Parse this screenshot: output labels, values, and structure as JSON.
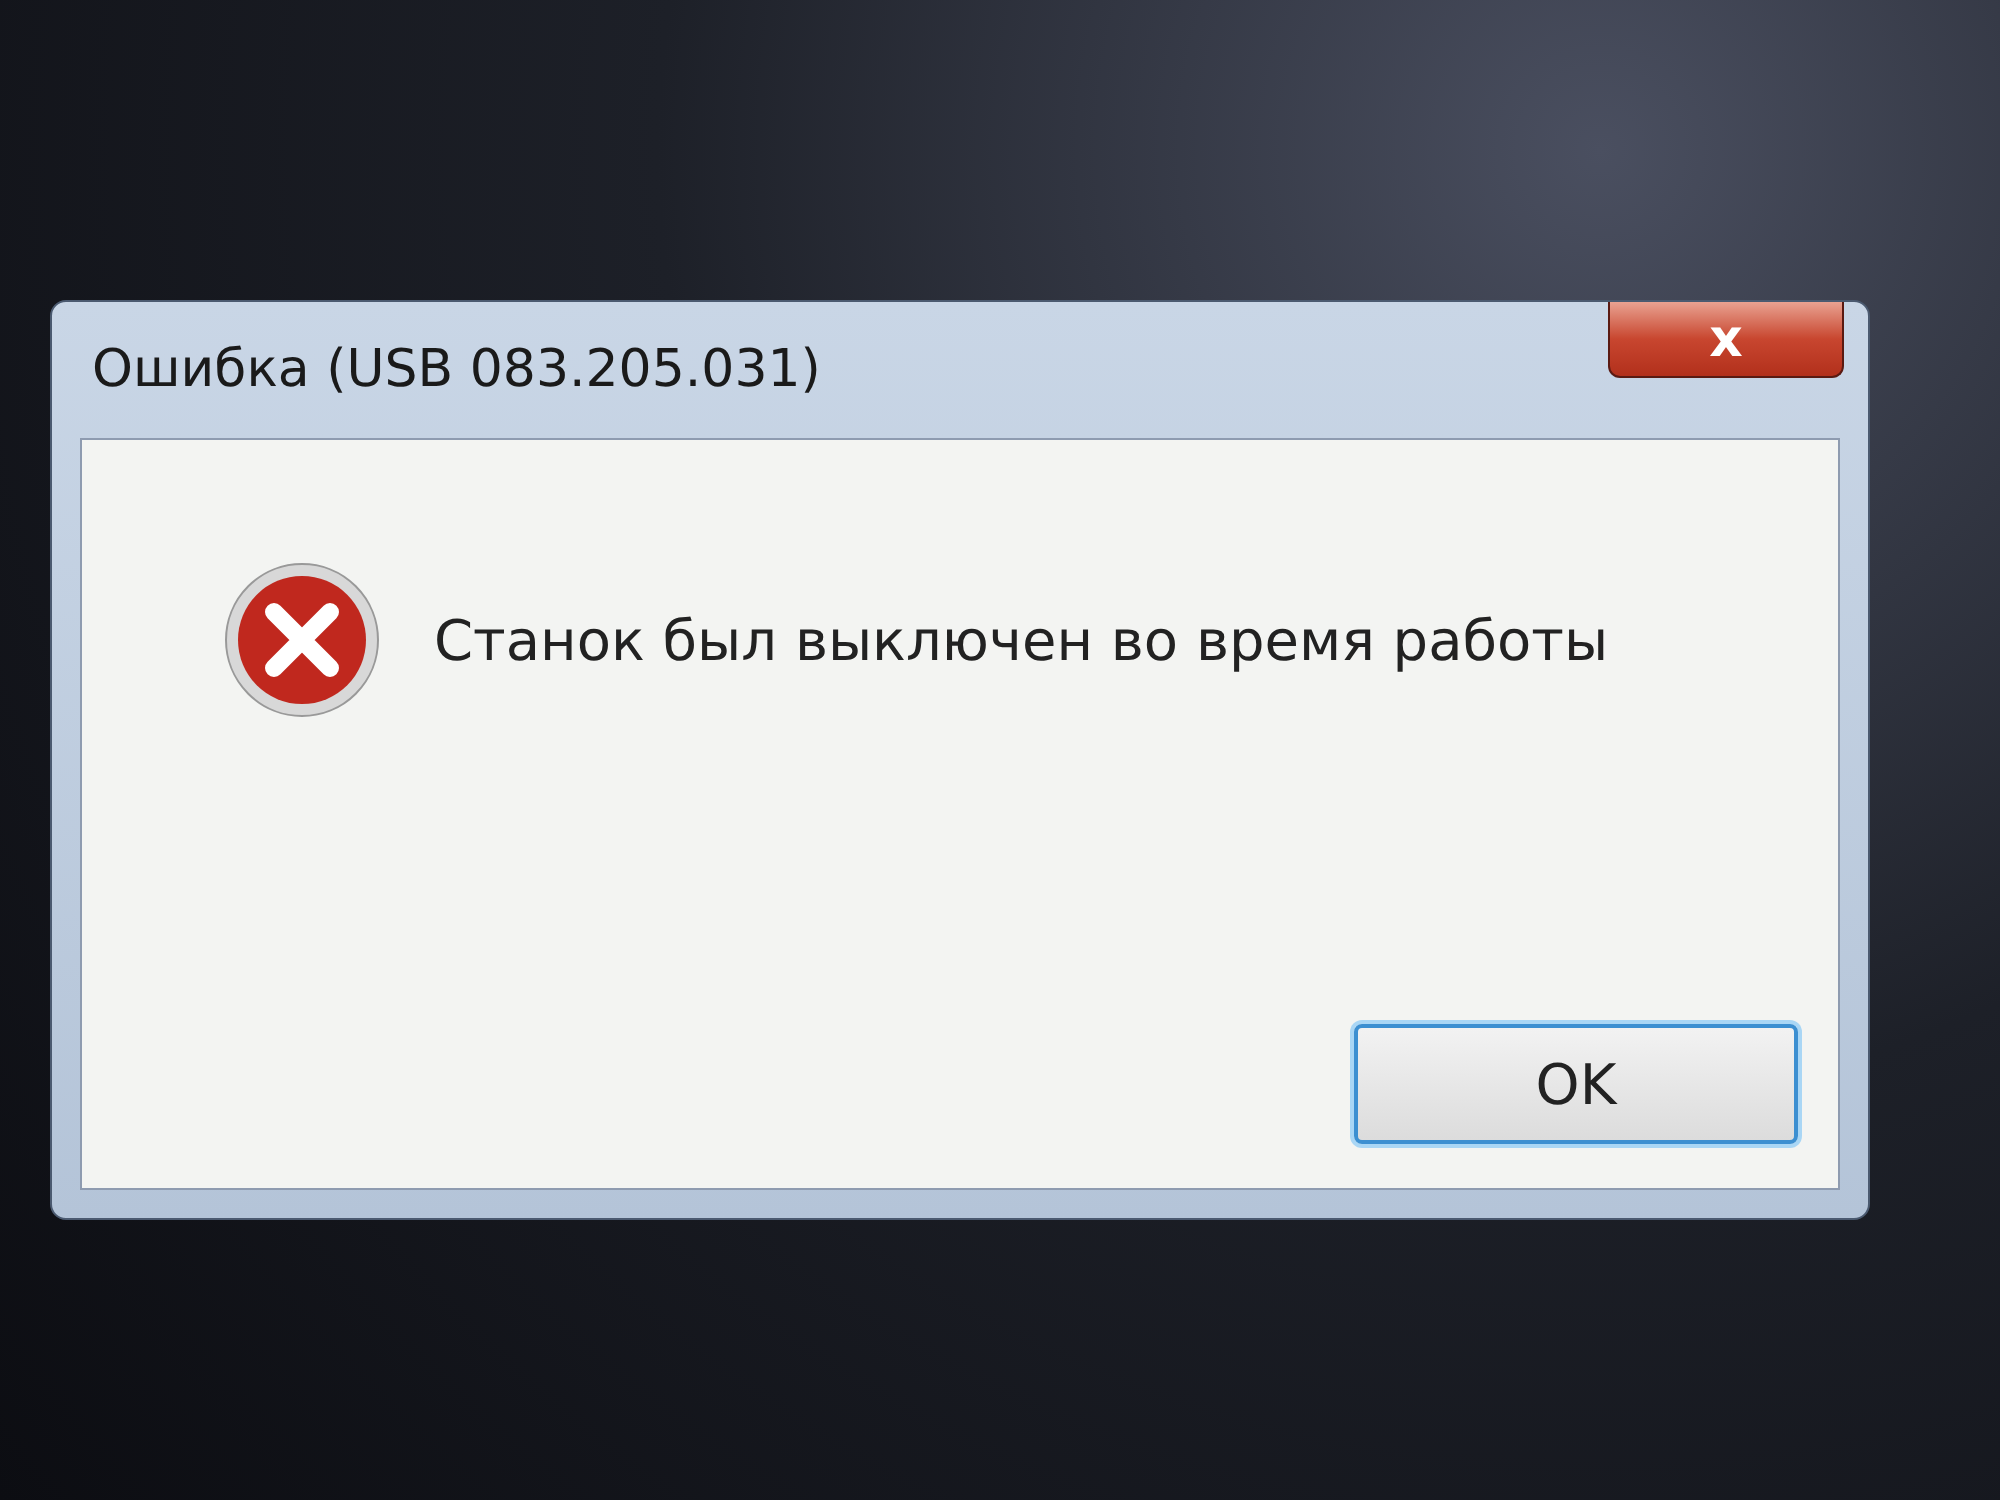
{
  "window": {
    "title": "Ошибка (USB 083.205.031)",
    "close": "x"
  },
  "message": "Станок был выключен во время работы",
  "buttons": [
    {
      "label": "OK",
      "selected": true
    }
  ]
}
